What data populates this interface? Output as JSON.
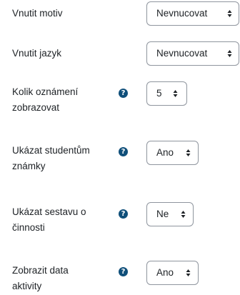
{
  "settings": [
    {
      "label_line1": "Vnutit motiv",
      "label_line2": "",
      "has_help": false,
      "value": "Nevnucovat"
    },
    {
      "label_line1": "Vnutit jazyk",
      "label_line2": "",
      "has_help": false,
      "value": "Nevnucovat"
    },
    {
      "label_line1": "Kolik oznámení",
      "label_line2": "zobrazovat",
      "has_help": true,
      "value": "5"
    },
    {
      "label_line1": "Ukázat studentům",
      "label_line2": "známky",
      "has_help": true,
      "value": "Ano"
    },
    {
      "label_line1": "Ukázat sestavu o",
      "label_line2": "činnosti",
      "has_help": true,
      "value": "Ne"
    },
    {
      "label_line1": "Zobrazit data",
      "label_line2": "aktivity",
      "has_help": true,
      "value": "Ano"
    }
  ],
  "icons": {
    "help": "question-circle-icon",
    "select": "sort-caret-icon"
  },
  "colors": {
    "help_icon": "#0f4f7a",
    "select_border": "#8f959e",
    "text": "#1d2125"
  }
}
